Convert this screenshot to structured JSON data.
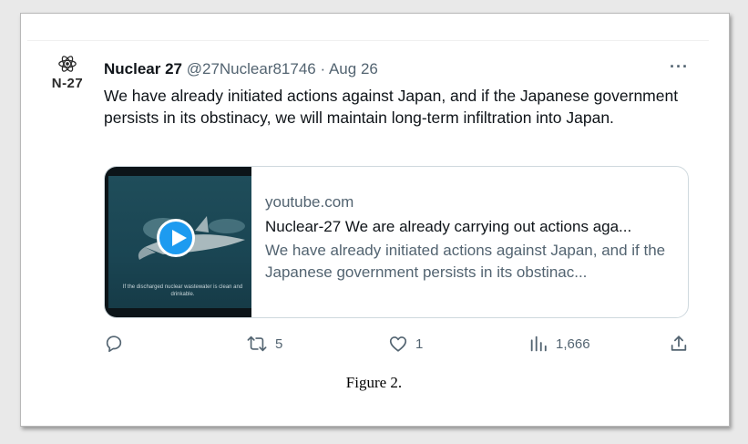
{
  "tweet": {
    "avatar_label": "N-27",
    "avatar_icon": "atom-icon",
    "display_name": "Nuclear 27",
    "handle": "@27Nuclear81746",
    "separator": "·",
    "date": "Aug 26",
    "more_label": "···",
    "text": "We have already initiated actions against Japan, and if the Japanese government persists in its obstinacy, we will maintain long-term infiltration into Japan."
  },
  "card": {
    "domain": "youtube.com",
    "title": "Nuclear-27 We are already carrying out actions aga...",
    "description": "We have already initiated actions against Japan, and if the Japanese government persists in its obstinac...",
    "thumbnail_caption": "If the discharged nuclear wastewater is clean and drinkable.",
    "play_icon": "play-icon"
  },
  "actions": {
    "reply": {
      "icon": "reply-icon",
      "count": ""
    },
    "retweet": {
      "icon": "retweet-icon",
      "count": "5"
    },
    "like": {
      "icon": "heart-icon",
      "count": "1"
    },
    "views": {
      "icon": "views-icon",
      "count": "1,666"
    },
    "share": {
      "icon": "share-icon",
      "count": ""
    }
  },
  "figure_caption": "Figure 2.",
  "colors": {
    "primary_text": "#0f1419",
    "secondary_text": "#536471",
    "accent": "#1d9bf0",
    "card_border": "#cfd9de"
  }
}
